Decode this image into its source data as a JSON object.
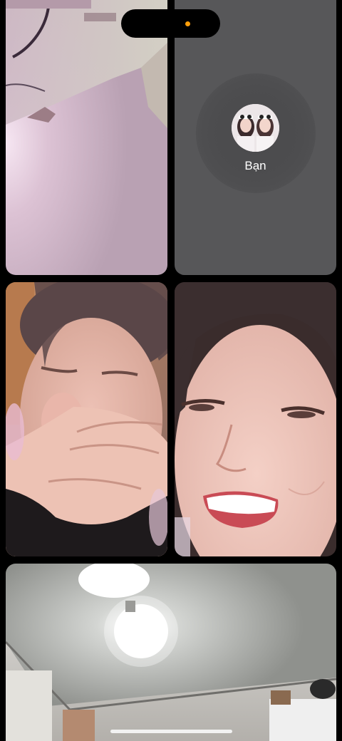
{
  "call": {
    "self_label": "Bạn",
    "active_indicator_color": "#ff9f0a"
  },
  "tiles": [
    {
      "id": "participant-1",
      "content": "camera-feed-ceiling-wall"
    },
    {
      "id": "self",
      "label": "Bạn",
      "content": "camera-off-avatar"
    },
    {
      "id": "participant-3",
      "content": "camera-feed-face-hand"
    },
    {
      "id": "participant-4",
      "content": "camera-feed-smiling-face"
    },
    {
      "id": "participant-5",
      "content": "camera-feed-ceiling-light"
    }
  ],
  "icons": [
    "camera-indicator-dot-icon",
    "home-indicator"
  ]
}
